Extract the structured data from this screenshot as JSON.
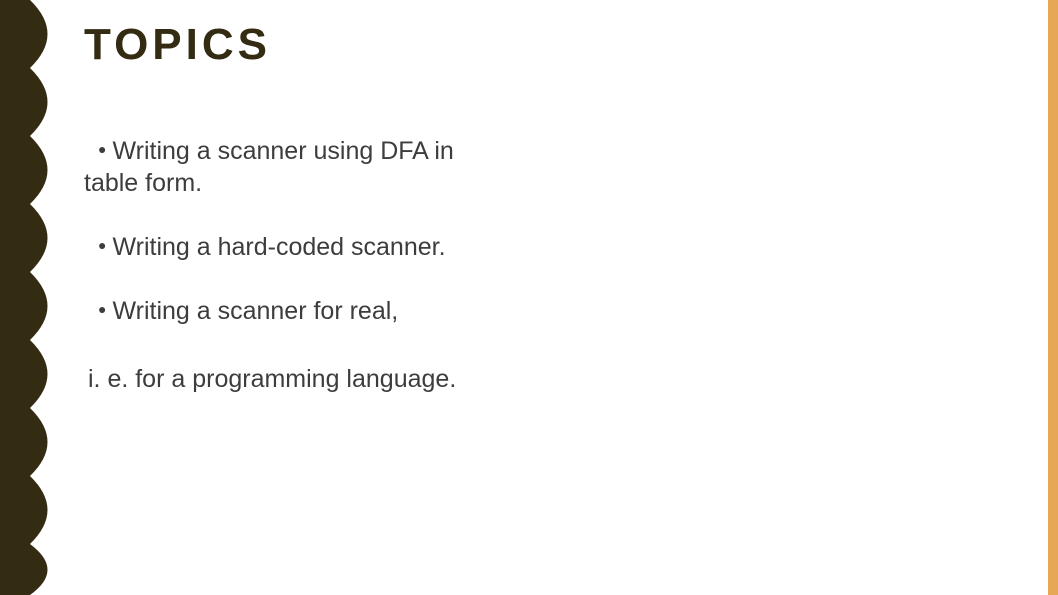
{
  "title": "TOPICS",
  "bullets": [
    "Writing a scanner using DFA in table form.",
    "Writing a hard-coded scanner.",
    "Writing a scanner for real,"
  ],
  "trailer": "i. e. for a programming language.",
  "colors": {
    "brown": "#332b12",
    "orange": "#e6a756"
  }
}
